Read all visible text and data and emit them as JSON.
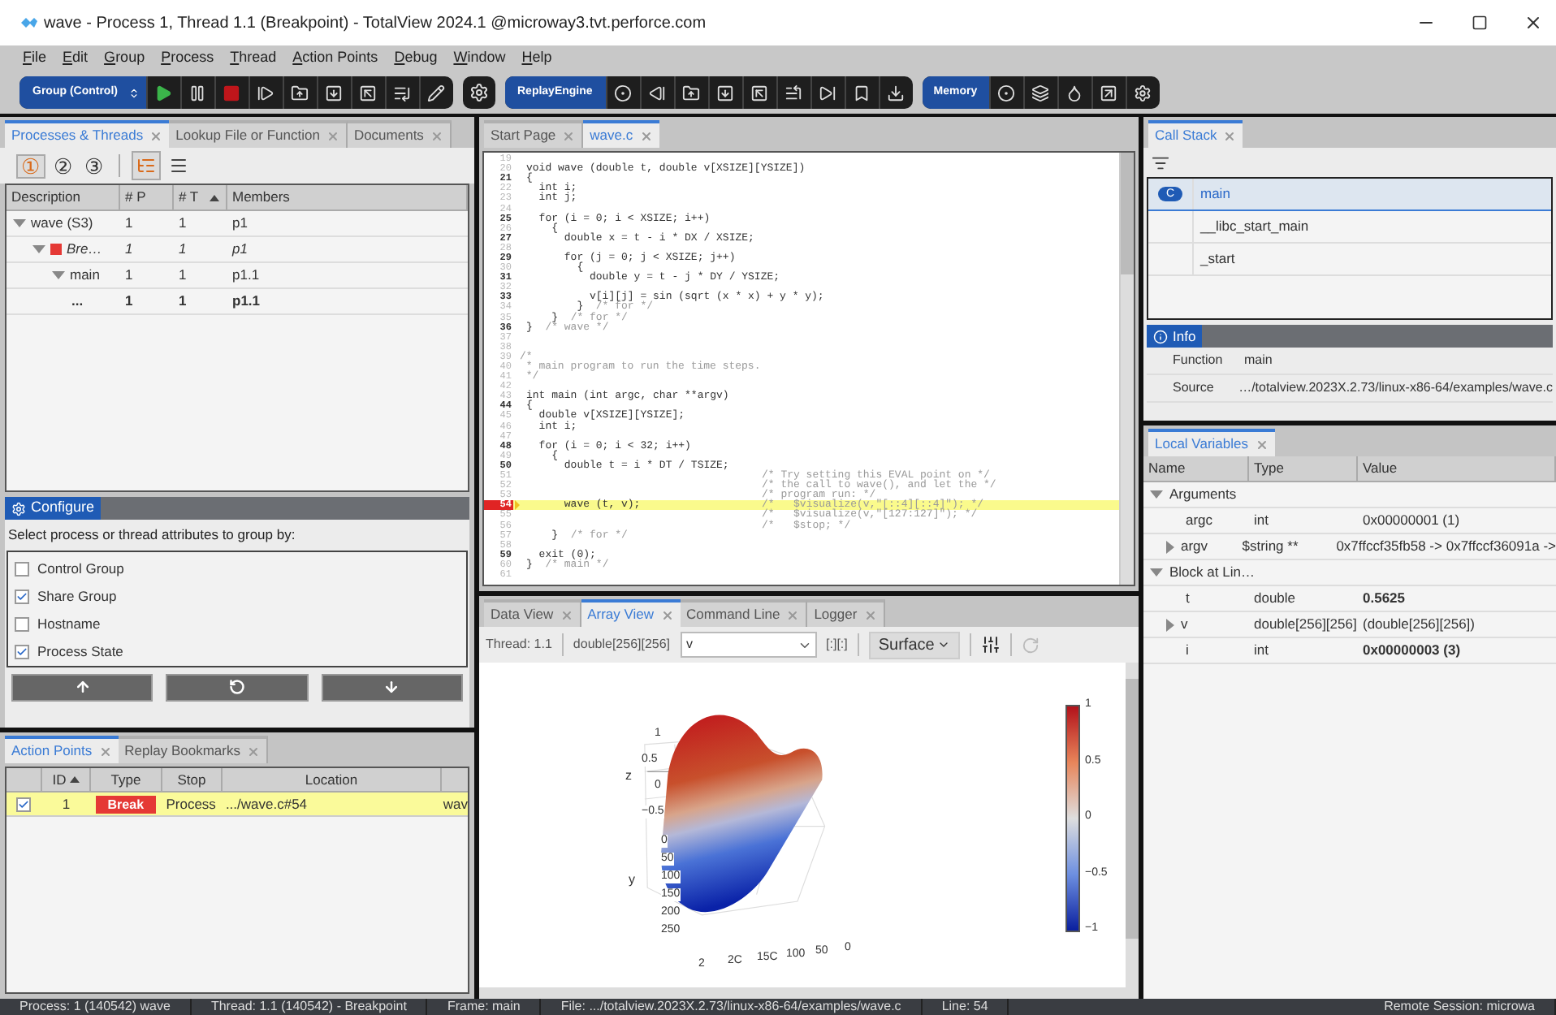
{
  "window": {
    "title": "wave -  Process 1, Thread 1.1 (Breakpoint) - TotalView 2024.1 @microway3.tvt.perforce.com"
  },
  "menu": [
    "File",
    "Edit",
    "Group",
    "Process",
    "Thread",
    "Action Points",
    "Debug",
    "Window",
    "Help"
  ],
  "toolbar": {
    "group_selector": "Group (Control)",
    "replay_label": "ReplayEngine",
    "memory_label": "Memory"
  },
  "processes_panel": {
    "tabs": [
      {
        "label": "Processes & Threads",
        "selected": true
      },
      {
        "label": "Lookup File or Function",
        "selected": false
      },
      {
        "label": "Documents",
        "selected": false
      }
    ],
    "levels": [
      {
        "label": "①",
        "selected": true
      },
      {
        "label": "②",
        "selected": false
      },
      {
        "label": "③",
        "selected": false
      }
    ],
    "view_modes": [
      {
        "kind": "tree",
        "selected": true
      },
      {
        "kind": "list",
        "selected": false
      }
    ],
    "columns": [
      {
        "label": "Description",
        "sorted": false
      },
      {
        "label": "# P",
        "sorted": false
      },
      {
        "label": "# T",
        "sorted": true
      },
      {
        "label": "Members",
        "sorted": false
      }
    ],
    "rows": [
      {
        "description": "wave (S3)",
        "p": "1",
        "t": "1",
        "members": "p1",
        "bold": false,
        "italic": false,
        "expanded": true,
        "children": [
          {
            "description": "Bre…",
            "p": "1",
            "t": "1",
            "members": "p1",
            "bold": false,
            "italic": true,
            "color": "#e53935",
            "expanded": true,
            "children": [
              {
                "description": "main",
                "p": "1",
                "t": "1",
                "members": "p1.1",
                "bold": false,
                "italic": false,
                "expanded": true,
                "children": [
                  {
                    "description": "...",
                    "p": "1",
                    "t": "1",
                    "members": "p1.1",
                    "bold": true,
                    "italic": false
                  }
                ]
              }
            ]
          }
        ]
      }
    ]
  },
  "configure": {
    "title": "Configure",
    "prompt": "Select process or thread attributes to group by:",
    "options": [
      {
        "label": "Control Group",
        "checked": false
      },
      {
        "label": "Share Group",
        "checked": true
      },
      {
        "label": "Hostname",
        "checked": false
      },
      {
        "label": "Process State",
        "checked": true
      }
    ]
  },
  "action_points": {
    "tabs": [
      {
        "label": "Action Points",
        "selected": true
      },
      {
        "label": "Replay Bookmarks",
        "selected": false
      }
    ],
    "columns": [
      {
        "label": "ID",
        "sorted": true
      },
      {
        "label": "Type",
        "sorted": false
      },
      {
        "label": "Stop",
        "sorted": false
      },
      {
        "label": "Location",
        "sorted": false
      }
    ],
    "rows": [
      {
        "checked": true,
        "id": "1",
        "type": "Break",
        "stop": "Process",
        "location": ".../wave.c#54",
        "column_6": "wav"
      }
    ]
  },
  "editor": {
    "tabs": [
      {
        "label": "Start Page",
        "selected": false
      },
      {
        "label": "wave.c",
        "selected": true
      }
    ],
    "lines": [
      {
        "n": "19",
        "faded": true,
        "current": false,
        "breakpoint": false
      },
      {
        "n": "20",
        "code": "void wave (double t, double v[XSIZE][YSIZE])",
        "faded": true,
        "current": false,
        "breakpoint": false
      },
      {
        "n": "21",
        "code": "{",
        "faded": false,
        "current": false,
        "breakpoint": false
      },
      {
        "n": "22",
        "code": "  int i;",
        "faded": true,
        "current": false,
        "breakpoint": false
      },
      {
        "n": "23",
        "code": "  int j;",
        "faded": true,
        "current": false,
        "breakpoint": false
      },
      {
        "n": "24",
        "faded": true,
        "current": false,
        "breakpoint": false
      },
      {
        "n": "25",
        "code": "  for (i = 0; i < XSIZE; i++)",
        "faded": false,
        "current": false,
        "breakpoint": false
      },
      {
        "n": "26",
        "code": "    {",
        "faded": true,
        "current": false,
        "breakpoint": false
      },
      {
        "n": "27",
        "code": "      double x = t - i * DX / XSIZE;",
        "faded": false,
        "current": false,
        "breakpoint": false
      },
      {
        "n": "28",
        "faded": true,
        "current": false,
        "breakpoint": false
      },
      {
        "n": "29",
        "code": "      for (j = 0; j < XSIZE; j++)",
        "faded": false,
        "current": false,
        "breakpoint": false
      },
      {
        "n": "30",
        "code": "        {",
        "faded": true,
        "current": false,
        "breakpoint": false
      },
      {
        "n": "31",
        "code": "          double y = t - j * DY / YSIZE;",
        "faded": false,
        "current": false,
        "breakpoint": false
      },
      {
        "n": "32",
        "faded": true,
        "current": false,
        "breakpoint": false
      },
      {
        "n": "33",
        "code": "          v[i][j] = sin (sqrt (x * x) + y * y);",
        "faded": false,
        "current": false,
        "breakpoint": false
      },
      {
        "n": "34",
        "code": "        }",
        "comment": "  /* for */",
        "faded": true,
        "current": false,
        "breakpoint": false
      },
      {
        "n": "35",
        "code": "    }",
        "comment": "  /* for */",
        "faded": true,
        "current": false,
        "breakpoint": false
      },
      {
        "n": "36",
        "code": "}",
        "comment": "  /* wave */",
        "faded": false,
        "current": false,
        "breakpoint": false
      },
      {
        "n": "37",
        "faded": true,
        "current": false,
        "breakpoint": false
      },
      {
        "n": "38",
        "faded": true,
        "current": false,
        "breakpoint": false
      },
      {
        "n": "39",
        "comment": "/*",
        "faded": true,
        "current": false,
        "breakpoint": false
      },
      {
        "n": "40",
        "comment": " * main program to run the time steps.",
        "faded": true,
        "current": false,
        "breakpoint": false
      },
      {
        "n": "41",
        "comment": " */",
        "faded": true,
        "current": false,
        "breakpoint": false
      },
      {
        "n": "42",
        "faded": true,
        "current": false,
        "breakpoint": false
      },
      {
        "n": "43",
        "code": "int main (int argc, char **argv)",
        "faded": true,
        "current": false,
        "breakpoint": false
      },
      {
        "n": "44",
        "code": "{",
        "faded": false,
        "current": false,
        "breakpoint": false
      },
      {
        "n": "45",
        "code": "  double v[XSIZE][YSIZE];",
        "faded": true,
        "current": false,
        "breakpoint": false
      },
      {
        "n": "46",
        "code": "  int i;",
        "faded": true,
        "current": false,
        "breakpoint": false
      },
      {
        "n": "47",
        "faded": true,
        "current": false,
        "breakpoint": false
      },
      {
        "n": "48",
        "code": "  for (i = 0; i < 32; i++)",
        "faded": false,
        "current": false,
        "breakpoint": false
      },
      {
        "n": "49",
        "code": "    {",
        "faded": true,
        "current": false,
        "breakpoint": false
      },
      {
        "n": "50",
        "code": "      double t = i * DT / TSIZE;",
        "faded": false,
        "current": false,
        "breakpoint": false
      },
      {
        "n": "51",
        "comment": "/* Try setting this EVAL point on */",
        "kind": "aligned",
        "faded": true,
        "current": false,
        "breakpoint": false
      },
      {
        "n": "52",
        "comment": "/* the call to wave(), and let the */",
        "kind": "aligned",
        "faded": true,
        "current": false,
        "breakpoint": false
      },
      {
        "n": "53",
        "comment": "/* program run: */",
        "kind": "aligned",
        "faded": true,
        "current": false,
        "breakpoint": false
      },
      {
        "n": "54",
        "code": "      wave (t, v);",
        "comment": "/*   $visualize(v,\"[::4][::4]\"); */",
        "kind": "aligned",
        "faded": false,
        "current": true,
        "breakpoint": true
      },
      {
        "n": "55",
        "comment": "/*   $visualize(v,\"[127:127]\"); */",
        "kind": "aligned",
        "faded": true,
        "current": false,
        "breakpoint": false
      },
      {
        "n": "56",
        "comment": "/*   $stop; */",
        "kind": "aligned",
        "faded": true,
        "current": false,
        "breakpoint": false
      },
      {
        "n": "57",
        "code": "    }",
        "comment": "  /* for */",
        "faded": true,
        "current": false,
        "breakpoint": false
      },
      {
        "n": "58",
        "faded": true,
        "current": false,
        "breakpoint": false
      },
      {
        "n": "59",
        "code": "  exit (0);",
        "faded": false,
        "current": false,
        "breakpoint": false
      },
      {
        "n": "60",
        "code": "}",
        "comment": "  /* main */",
        "faded": true,
        "current": false,
        "breakpoint": false
      },
      {
        "n": "61",
        "faded": true,
        "current": false,
        "breakpoint": false
      }
    ]
  },
  "array_view": {
    "tabs": [
      {
        "label": "Data View",
        "selected": false
      },
      {
        "label": "Array View",
        "selected": true
      },
      {
        "label": "Command Line",
        "selected": false
      },
      {
        "label": "Logger",
        "selected": false
      }
    ],
    "thread": "Thread: 1.1",
    "type": "double[256][256]",
    "expression": "v",
    "slice": "[:][:]",
    "mode": "Surface",
    "z_label": "z",
    "y_label": "y",
    "z_ticks": [
      "1",
      "0.5",
      "0",
      "−0.5"
    ],
    "y_ticks": [
      "0",
      "50",
      "100",
      "150",
      "200",
      "250"
    ],
    "x_ticks": [
      "2",
      "2C",
      "15C",
      "100",
      "50",
      "0"
    ],
    "scale_ticks": [
      "1",
      "0.5",
      "0",
      "−0.5",
      "−1"
    ]
  },
  "call_stack": {
    "tabs": [
      {
        "label": "Call Stack",
        "selected": true
      }
    ],
    "frames": [
      {
        "badge": "C",
        "name": "main",
        "selected": true
      },
      {
        "name": "__libc_start_main",
        "selected": false
      },
      {
        "name": "_start",
        "selected": false
      }
    ]
  },
  "info": {
    "title": "Info",
    "rows": [
      {
        "label": "Function",
        "value": "main"
      },
      {
        "label": "Source",
        "value": "…/totalview.2023X.2.73/linux-x86-64/examples/wave.c"
      }
    ]
  },
  "local_variables": {
    "tabs": [
      {
        "label": "Local Variables",
        "selected": true
      }
    ],
    "columns": [
      "Name",
      "Type",
      "Value"
    ],
    "rows": [
      {
        "name": "Arguments",
        "expanded": true,
        "children": [
          {
            "name": "argc",
            "type": "int",
            "value": "0x00000001 (1)",
            "changed": false
          },
          {
            "name": "argv",
            "type": "$string **",
            "value": "0x7ffccf35fb58 -> 0x7ffccf36091a ->",
            "changed": false,
            "expanded": false
          }
        ]
      },
      {
        "name": "Block at Lin…",
        "expanded": true,
        "children": [
          {
            "name": "t",
            "type": "double",
            "value": "0.5625",
            "changed": true
          },
          {
            "name": "v",
            "type": "double[256][256]",
            "value": "(double[256][256])",
            "changed": false,
            "expanded": false
          },
          {
            "name": "i",
            "type": "int",
            "value": "0x00000003 (3)",
            "changed": true
          }
        ]
      }
    ]
  },
  "status_bar": [
    "Process: 1 (140542) wave",
    "Thread: 1.1 (140542) - Breakpoint",
    "Frame: main",
    "File: .../totalview.2023X.2.73/linux-x86-64/examples/wave.c",
    "Line: 54",
    "Remote Session: microwa"
  ]
}
